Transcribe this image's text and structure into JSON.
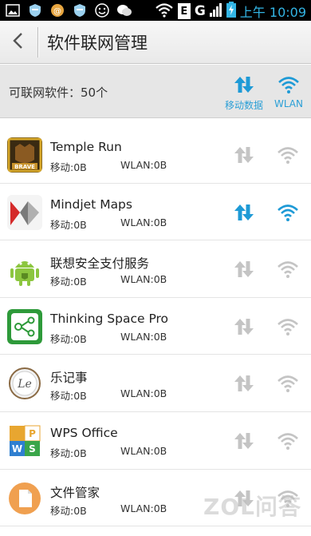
{
  "status_bar": {
    "network_type": "G",
    "carrier_box": "E",
    "clock": "上午 10:09"
  },
  "header": {
    "back_icon": "chevron-left-icon",
    "title": "软件联网管理"
  },
  "summary": {
    "count_text": "可联网软件：50个",
    "mobile_label": "移动数据",
    "wlan_label": "WLAN"
  },
  "colors": {
    "accent_blue": "#1e9ad6",
    "inactive_gray": "#c4c4c4"
  },
  "apps": [
    {
      "name": "Temple Run",
      "mobile_usage": "移动:0B",
      "wlan_usage": "WLAN:0B",
      "mobile_enabled": false,
      "wlan_enabled": false,
      "icon": "temple-run-app-icon"
    },
    {
      "name": "Mindjet Maps",
      "mobile_usage": "移动:0B",
      "wlan_usage": "WLAN:0B",
      "mobile_enabled": true,
      "wlan_enabled": true,
      "icon": "mindjet-maps-app-icon"
    },
    {
      "name": "联想安全支付服务",
      "mobile_usage": "移动:0B",
      "wlan_usage": "WLAN:0B",
      "mobile_enabled": false,
      "wlan_enabled": false,
      "icon": "android-app-icon"
    },
    {
      "name": "Thinking Space Pro",
      "mobile_usage": "移动:0B",
      "wlan_usage": "WLAN:0B",
      "mobile_enabled": false,
      "wlan_enabled": false,
      "icon": "thinking-space-app-icon"
    },
    {
      "name": "乐记事",
      "mobile_usage": "移动:0B",
      "wlan_usage": "WLAN:0B",
      "mobile_enabled": false,
      "wlan_enabled": false,
      "icon": "le-notes-app-icon"
    },
    {
      "name": "WPS Office",
      "mobile_usage": "移动:0B",
      "wlan_usage": "WLAN:0B",
      "mobile_enabled": false,
      "wlan_enabled": false,
      "icon": "wps-office-app-icon"
    },
    {
      "name": "文件管家",
      "mobile_usage": "移动:0B",
      "wlan_usage": "WLAN:0B",
      "mobile_enabled": false,
      "wlan_enabled": false,
      "icon": "file-manager-app-icon"
    }
  ],
  "watermark": "ZOL问答"
}
